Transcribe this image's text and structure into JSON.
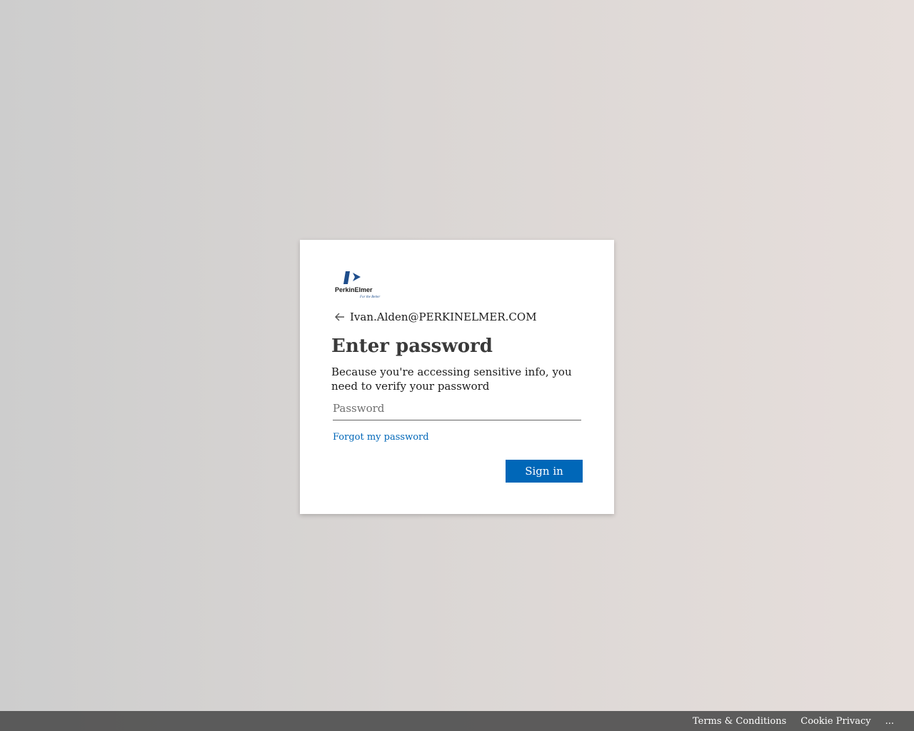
{
  "brand": {
    "logo_name": "PerkinElmer",
    "logo_tagline": "For the Better",
    "logo_color": "#1f4e8c"
  },
  "identity": {
    "back_icon": "arrow-left-icon",
    "email": "Ivan.Alden@PERKINELMER.COM"
  },
  "form": {
    "title": "Enter password",
    "description": "Because you're accessing sensitive info, you need to verify your password",
    "password_placeholder": "Password",
    "password_value": "",
    "forgot_link": "Forgot my password",
    "submit_label": "Sign in"
  },
  "footer": {
    "links": [
      "Terms & Conditions",
      "Cookie Privacy",
      "..."
    ]
  },
  "colors": {
    "accent": "#0067b8",
    "footer_bg": "#505050"
  }
}
